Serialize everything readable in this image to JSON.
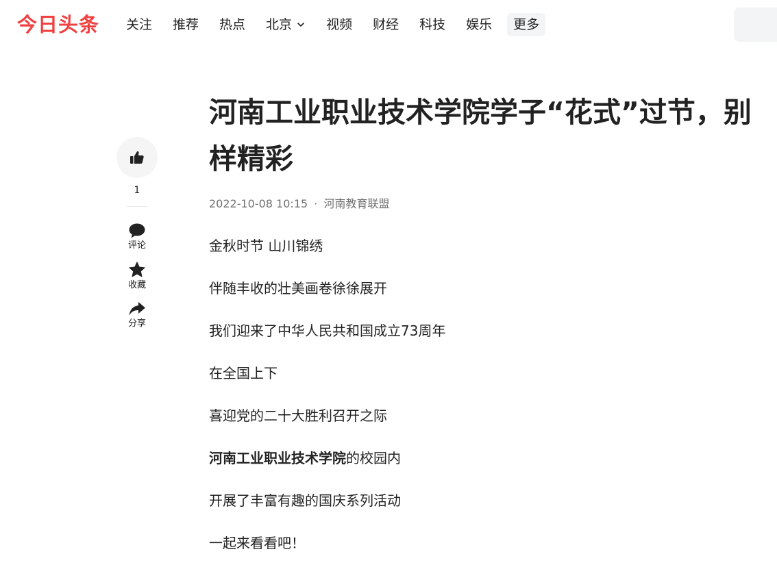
{
  "header": {
    "logo": "今日头条",
    "nav": [
      {
        "label": "关注"
      },
      {
        "label": "推荐"
      },
      {
        "label": "热点"
      },
      {
        "label": "北京"
      },
      {
        "label": "视频"
      },
      {
        "label": "财经"
      },
      {
        "label": "科技"
      },
      {
        "label": "娱乐"
      }
    ],
    "more_label": "更多",
    "city_dropdown_icon": "chevron-down-icon"
  },
  "sidebar": {
    "like_icon": "thumbs-up-icon",
    "like_count": "1",
    "comment_label": "评论",
    "comment_icon": "comment-icon",
    "favorite_label": "收藏",
    "favorite_icon": "star-icon",
    "share_label": "分享",
    "share_icon": "share-icon"
  },
  "article": {
    "title": "河南工业职业技术学院学子“花式”过节，别样精彩",
    "date": "2022-10-08 10:15",
    "separator": "·",
    "source": "河南教育联盟",
    "paragraphs": {
      "p1": "金秋时节 山川锦绣",
      "p2": "伴随丰收的壮美画卷徐徐展开",
      "p3": "我们迎来了中华人民共和国成立73周年",
      "p4": "在全国上下",
      "p5": "喜迎党的二十大胜利召开之际",
      "p6_bold": "河南工业职业技术学院",
      "p6_rest": "的校园内",
      "p7": "开展了丰富有趣的国庆系列活动",
      "p8": "一起来看看吧！"
    }
  },
  "colors": {
    "brand": "#f04142",
    "text": "#222222",
    "meta": "#707070",
    "chip_bg": "#f3f4f6"
  }
}
